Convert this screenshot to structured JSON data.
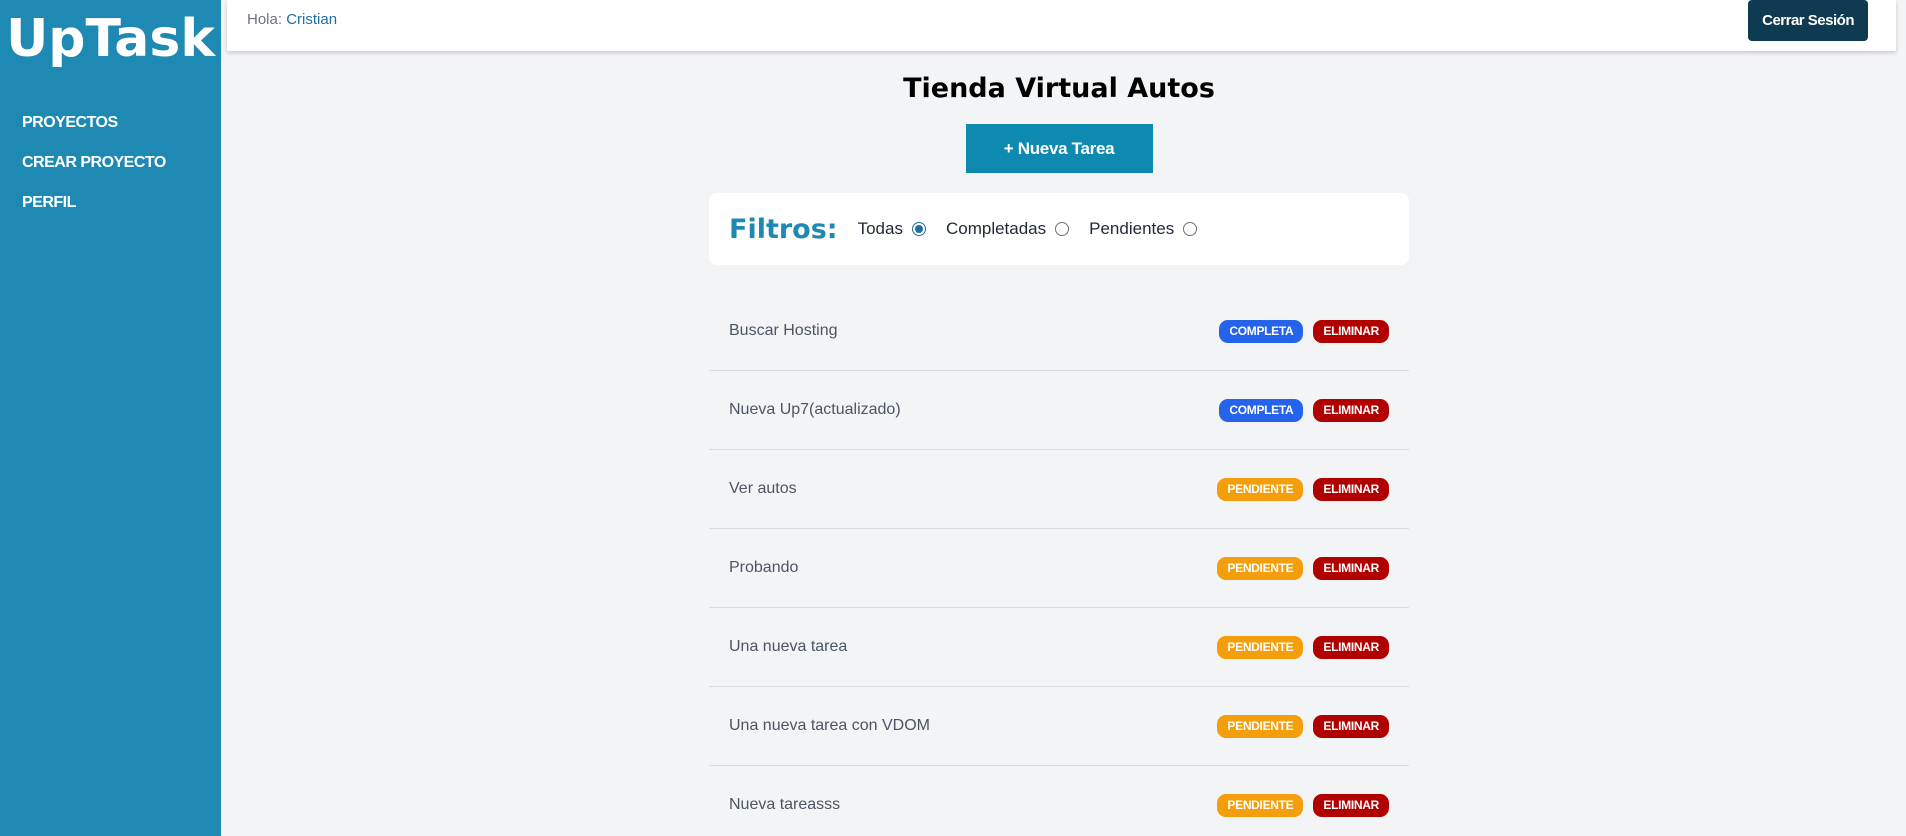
{
  "sidebar": {
    "logo": "UpTask",
    "items": [
      {
        "label": "PROYECTOS"
      },
      {
        "label": "CREAR PROYECTO"
      },
      {
        "label": "PERFIL"
      }
    ]
  },
  "header": {
    "greeting": "Hola:",
    "user": "Cristian",
    "logout_label": "Cerrar Sesión"
  },
  "project": {
    "title": "Tienda Virtual Autos",
    "new_task_label": "+ Nueva Tarea"
  },
  "filters": {
    "title": "Filtros:",
    "options": [
      {
        "label": "Todas",
        "checked": true
      },
      {
        "label": "Completadas",
        "checked": false
      },
      {
        "label": "Pendientes",
        "checked": false
      }
    ]
  },
  "tasks": [
    {
      "name": "Buscar Hosting",
      "status": "COMPLETA",
      "state": "complete",
      "delete_label": "ELIMINAR"
    },
    {
      "name": "Nueva Up7(actualizado)",
      "status": "COMPLETA",
      "state": "complete",
      "delete_label": "ELIMINAR"
    },
    {
      "name": "Ver autos",
      "status": "PENDIENTE",
      "state": "pending",
      "delete_label": "ELIMINAR"
    },
    {
      "name": "Probando",
      "status": "PENDIENTE",
      "state": "pending",
      "delete_label": "ELIMINAR"
    },
    {
      "name": "Una nueva tarea",
      "status": "PENDIENTE",
      "state": "pending",
      "delete_label": "ELIMINAR"
    },
    {
      "name": "Una nueva tarea con VDOM",
      "status": "PENDIENTE",
      "state": "pending",
      "delete_label": "ELIMINAR"
    },
    {
      "name": "Nueva tareasss",
      "status": "PENDIENTE",
      "state": "pending",
      "delete_label": "ELIMINAR"
    }
  ],
  "colors": {
    "sidebar": "#1e8ab3",
    "complete": "#2563eb",
    "pending": "#f59e0b",
    "delete": "#b00000",
    "logout": "#0e3b52"
  }
}
